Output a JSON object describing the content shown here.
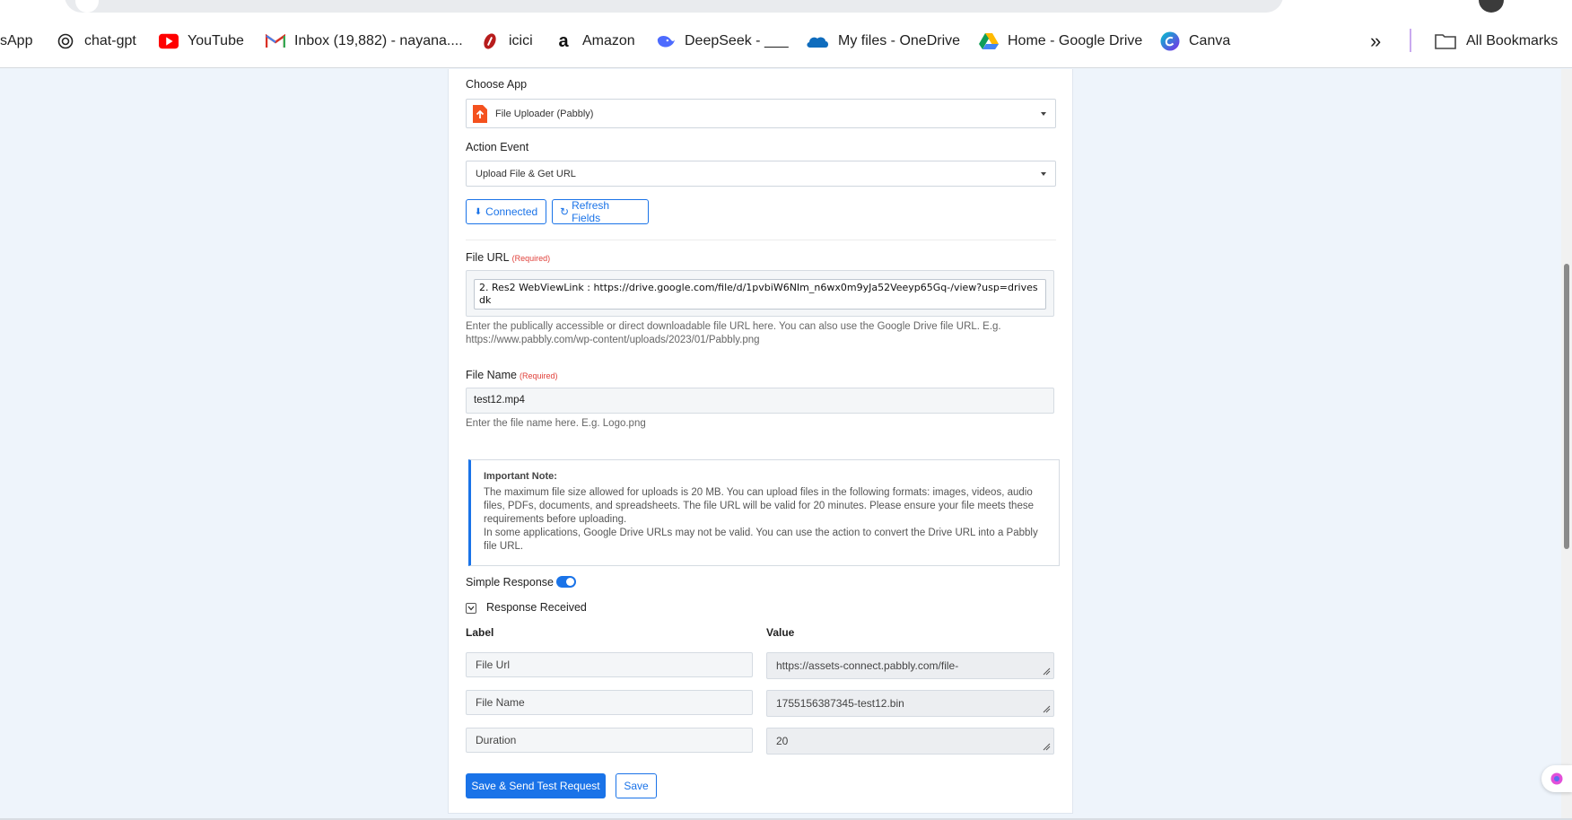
{
  "bookmarks": {
    "items": [
      {
        "label": "sApp",
        "icon": "whatsapp-icon"
      },
      {
        "label": "chat-gpt",
        "icon": "chatgpt-icon"
      },
      {
        "label": "YouTube",
        "icon": "youtube-icon"
      },
      {
        "label": "Inbox (19,882) - nayana....",
        "icon": "gmail-icon"
      },
      {
        "label": "icici",
        "icon": "icici-icon"
      },
      {
        "label": "Amazon",
        "icon": "amazon-icon"
      },
      {
        "label": "DeepSeek - ___",
        "icon": "deepseek-icon"
      },
      {
        "label": "My files - OneDrive",
        "icon": "onedrive-icon"
      },
      {
        "label": "Home - Google Drive",
        "icon": "google-drive-icon"
      },
      {
        "label": "Canva",
        "icon": "canva-icon"
      }
    ],
    "overflow": "»",
    "all_bookmarks": "All Bookmarks"
  },
  "form": {
    "choose_app_label": "Choose App",
    "app_value": "File Uploader (Pabbly)",
    "action_event_label": "Action Event",
    "action_event_value": "Upload File & Get URL",
    "connected_label": "Connected",
    "refresh_label": "Refresh Fields",
    "file_url_label": "File URL",
    "required": "(Required)",
    "file_url_value": "2. Res2 WebViewLink : https://drive.google.com/file/d/1pvbiW6NIm_n6wx0m9yJa52Veeyp65Gq-/view?usp=drivesdk",
    "file_url_help": "Enter the publically accessible or direct downloadable file URL here. You can also use the Google Drive file URL. E.g. https://www.pabbly.com/wp-content/uploads/2023/01/Pabbly.png",
    "file_name_label": "File Name",
    "file_name_value": "test12.mp4",
    "file_name_help": "Enter the file name here. E.g. Logo.png",
    "note_title": "Important Note:",
    "note_body_1": "The maximum file size allowed for uploads is 20 MB. You can upload files in the following formats: images, videos, audio files, PDFs, documents, and spreadsheets. The file URL will be valid for 20 minutes. Please ensure your file meets these requirements before uploading.",
    "note_body_2": "In some applications, Google Drive URLs may not be valid. You can use the action to convert the Drive URL into a Pabbly file URL.",
    "simple_response_label": "Simple Response",
    "simple_response_on": true,
    "response_received_label": "Response Received",
    "col_label": "Label",
    "col_value": "Value",
    "rows": [
      {
        "label": "File Url",
        "value": "https://assets-connect.pabbly.com/file-"
      },
      {
        "label": "File Name",
        "value": "1755156387345-test12.bin"
      },
      {
        "label": "Duration",
        "value": "20"
      }
    ],
    "save_send_label": "Save & Send Test Request",
    "save_label": "Save"
  },
  "colors": {
    "accent": "#1a73e8",
    "page_bg": "#eef4fb",
    "required": "#e0403a"
  }
}
